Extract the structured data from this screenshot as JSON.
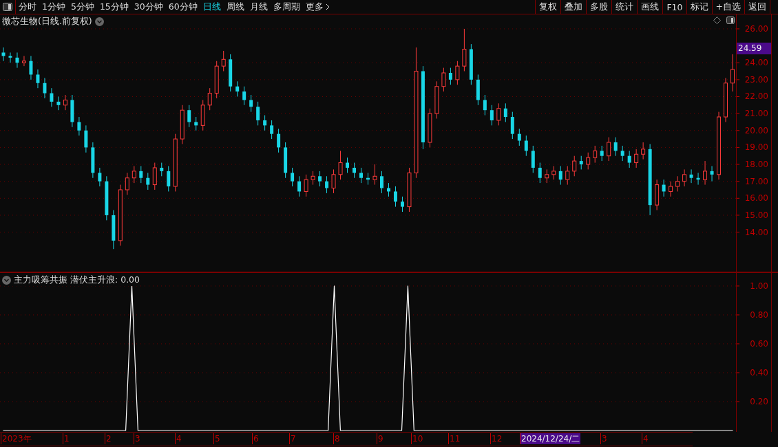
{
  "toolbar": {
    "periods": [
      {
        "label": "分时",
        "selected": false
      },
      {
        "label": "1分钟",
        "selected": false
      },
      {
        "label": "5分钟",
        "selected": false
      },
      {
        "label": "15分钟",
        "selected": false
      },
      {
        "label": "30分钟",
        "selected": false
      },
      {
        "label": "60分钟",
        "selected": false
      },
      {
        "label": "日线",
        "selected": true
      },
      {
        "label": "周线",
        "selected": false
      },
      {
        "label": "月线",
        "selected": false
      },
      {
        "label": "多周期",
        "selected": false
      },
      {
        "label": "更多",
        "selected": false
      }
    ],
    "actions": [
      "复权",
      "叠加",
      "多股",
      "统计",
      "画线",
      "F10",
      "标记",
      "+自选",
      "返回"
    ]
  },
  "price_chart": {
    "title": "微芯生物(日线.前复权)",
    "last_price": "24.59",
    "chart_data": {
      "type": "candlestick",
      "grid": true,
      "ylim": [
        11.75,
        26.85
      ],
      "yticks": [
        {
          "value": 26,
          "label": "26.00"
        },
        {
          "value": 24,
          "label": "24.00"
        },
        {
          "value": 23,
          "label": "23.00"
        },
        {
          "value": 22,
          "label": "22.00"
        },
        {
          "value": 21,
          "label": "21.00"
        },
        {
          "value": 20,
          "label": "20.00"
        },
        {
          "value": 19,
          "label": "19.00"
        },
        {
          "value": 18,
          "label": "18.00"
        },
        {
          "value": 17,
          "label": "17.00"
        },
        {
          "value": 16,
          "label": "16.00"
        },
        {
          "value": 15,
          "label": "15.00"
        },
        {
          "value": 14,
          "label": "14.00"
        }
      ],
      "ohlc": [
        [
          24.6,
          24.9,
          24.1,
          24.4
        ],
        [
          24.4,
          24.6,
          24.0,
          24.3
        ],
        [
          24.3,
          24.6,
          23.7,
          24.0
        ],
        [
          24.0,
          24.4,
          23.8,
          24.1
        ],
        [
          24.1,
          24.4,
          23.0,
          23.3
        ],
        [
          23.3,
          23.6,
          22.5,
          22.8
        ],
        [
          22.8,
          23.1,
          21.9,
          22.2
        ],
        [
          22.2,
          22.5,
          21.4,
          21.7
        ],
        [
          21.7,
          22.0,
          21.2,
          21.5
        ],
        [
          21.5,
          22.1,
          21.2,
          21.8
        ],
        [
          21.8,
          22.1,
          20.2,
          20.5
        ],
        [
          20.5,
          20.8,
          19.7,
          20.0
        ],
        [
          20.0,
          20.3,
          18.7,
          19.0
        ],
        [
          19.0,
          19.3,
          17.2,
          17.5
        ],
        [
          17.5,
          17.8,
          16.7,
          17.0
        ],
        [
          17.0,
          17.3,
          14.7,
          15.0
        ],
        [
          15.0,
          15.3,
          13.0,
          13.5
        ],
        [
          13.5,
          16.8,
          13.2,
          16.5
        ],
        [
          16.5,
          17.5,
          16.2,
          17.2
        ],
        [
          17.2,
          17.9,
          16.9,
          17.6
        ],
        [
          17.6,
          17.9,
          16.9,
          17.2
        ],
        [
          17.2,
          17.5,
          16.5,
          16.8
        ],
        [
          16.8,
          18.1,
          16.5,
          17.8
        ],
        [
          17.8,
          18.1,
          17.3,
          17.6
        ],
        [
          17.6,
          17.9,
          16.4,
          16.7
        ],
        [
          16.7,
          19.8,
          16.4,
          19.5
        ],
        [
          19.5,
          21.5,
          19.2,
          21.2
        ],
        [
          21.2,
          21.5,
          20.2,
          20.5
        ],
        [
          20.5,
          20.8,
          20.0,
          20.3
        ],
        [
          20.3,
          21.8,
          20.0,
          21.5
        ],
        [
          21.5,
          22.5,
          21.2,
          22.2
        ],
        [
          22.2,
          24.1,
          21.9,
          23.8
        ],
        [
          23.8,
          24.7,
          23.5,
          24.2
        ],
        [
          24.2,
          24.5,
          22.3,
          22.6
        ],
        [
          22.6,
          22.9,
          22.0,
          22.3
        ],
        [
          22.3,
          22.6,
          21.5,
          21.8
        ],
        [
          21.8,
          22.1,
          21.1,
          21.4
        ],
        [
          21.4,
          21.7,
          20.3,
          20.6
        ],
        [
          20.6,
          20.9,
          20.0,
          20.3
        ],
        [
          20.3,
          20.6,
          19.5,
          19.8
        ],
        [
          19.8,
          20.1,
          18.7,
          19.0
        ],
        [
          19.0,
          19.3,
          17.2,
          17.5
        ],
        [
          17.5,
          17.8,
          16.7,
          17.0
        ],
        [
          17.0,
          17.3,
          16.1,
          16.4
        ],
        [
          16.4,
          17.4,
          16.1,
          17.1
        ],
        [
          17.1,
          17.6,
          16.8,
          17.3
        ],
        [
          17.3,
          17.6,
          16.7,
          17.0
        ],
        [
          17.0,
          17.3,
          16.3,
          16.6
        ],
        [
          16.6,
          17.7,
          16.3,
          17.4
        ],
        [
          17.4,
          18.8,
          17.1,
          18.1
        ],
        [
          18.1,
          18.4,
          17.5,
          17.8
        ],
        [
          17.8,
          18.1,
          17.2,
          17.5
        ],
        [
          17.5,
          17.8,
          16.9,
          17.2
        ],
        [
          17.2,
          17.5,
          16.8,
          17.1
        ],
        [
          17.1,
          18.0,
          16.8,
          17.3
        ],
        [
          17.3,
          17.6,
          16.3,
          16.6
        ],
        [
          16.6,
          16.9,
          16.1,
          16.4
        ],
        [
          16.4,
          16.7,
          15.5,
          15.8
        ],
        [
          15.8,
          16.1,
          15.2,
          15.5
        ],
        [
          15.5,
          17.8,
          15.2,
          17.5
        ],
        [
          17.5,
          24.9,
          17.2,
          23.5
        ],
        [
          23.5,
          23.8,
          18.9,
          19.3
        ],
        [
          19.3,
          21.3,
          19.0,
          21.0
        ],
        [
          21.0,
          22.9,
          20.7,
          22.6
        ],
        [
          22.6,
          23.7,
          22.3,
          23.4
        ],
        [
          23.4,
          23.7,
          22.7,
          23.0
        ],
        [
          23.0,
          24.1,
          22.7,
          23.8
        ],
        [
          23.8,
          26.0,
          23.5,
          24.8
        ],
        [
          24.8,
          25.1,
          22.7,
          23.0
        ],
        [
          23.0,
          23.3,
          21.5,
          21.8
        ],
        [
          21.8,
          22.1,
          20.9,
          21.2
        ],
        [
          21.2,
          21.5,
          20.3,
          20.6
        ],
        [
          20.6,
          21.6,
          20.3,
          21.3
        ],
        [
          21.3,
          21.6,
          20.5,
          20.8
        ],
        [
          20.8,
          21.1,
          19.5,
          19.8
        ],
        [
          19.8,
          20.1,
          19.1,
          19.4
        ],
        [
          19.4,
          19.7,
          18.5,
          18.8
        ],
        [
          18.8,
          19.1,
          17.5,
          17.8
        ],
        [
          17.8,
          18.1,
          16.9,
          17.2
        ],
        [
          17.2,
          17.7,
          16.9,
          17.4
        ],
        [
          17.4,
          17.9,
          17.1,
          17.6
        ],
        [
          17.6,
          17.9,
          16.8,
          17.1
        ],
        [
          17.1,
          17.9,
          16.8,
          17.6
        ],
        [
          17.6,
          18.5,
          17.3,
          18.2
        ],
        [
          18.2,
          18.5,
          17.7,
          18.0
        ],
        [
          18.0,
          18.7,
          17.7,
          18.4
        ],
        [
          18.4,
          19.1,
          18.1,
          18.8
        ],
        [
          18.8,
          19.1,
          18.2,
          18.5
        ],
        [
          18.5,
          19.6,
          18.2,
          19.3
        ],
        [
          19.3,
          19.6,
          18.5,
          18.8
        ],
        [
          18.8,
          19.1,
          18.2,
          18.5
        ],
        [
          18.5,
          18.8,
          17.8,
          18.1
        ],
        [
          18.1,
          18.9,
          17.8,
          18.6
        ],
        [
          18.6,
          19.3,
          18.3,
          18.9
        ],
        [
          18.9,
          19.2,
          15.0,
          15.6
        ],
        [
          15.6,
          17.1,
          15.3,
          16.8
        ],
        [
          16.8,
          17.1,
          16.1,
          16.4
        ],
        [
          16.4,
          17.0,
          16.1,
          16.7
        ],
        [
          16.7,
          17.3,
          16.4,
          17.0
        ],
        [
          17.0,
          17.7,
          16.7,
          17.4
        ],
        [
          17.4,
          17.7,
          16.9,
          17.2
        ],
        [
          17.2,
          17.5,
          16.8,
          17.1
        ],
        [
          17.1,
          18.2,
          16.8,
          17.6
        ],
        [
          17.6,
          17.9,
          17.0,
          17.4
        ],
        [
          17.4,
          21.1,
          17.1,
          20.8
        ],
        [
          20.8,
          23.1,
          20.5,
          22.8
        ],
        [
          22.8,
          24.5,
          22.3,
          23.6
        ]
      ]
    }
  },
  "indicator": {
    "reading": ": 0.00",
    "chart_data": {
      "type": "line",
      "title": "主力吸筹共振",
      "grid": true,
      "ylim": [
        0,
        1.09
      ],
      "yticks": [
        {
          "value": 1,
          "label": "1.00"
        },
        {
          "value": 0.8,
          "label": "0.80"
        },
        {
          "value": 0.6,
          "label": "0.60"
        },
        {
          "value": 0.4,
          "label": "0.40"
        },
        {
          "value": 0.2,
          "label": "0.20"
        }
      ],
      "series": [
        {
          "name": "潜伏主升浪",
          "color": "#ffffff",
          "values": [
            0,
            0,
            0,
            0,
            0,
            0,
            0,
            0,
            0,
            0,
            0,
            0,
            0,
            0,
            0,
            0,
            0,
            0,
            0,
            0,
            0,
            1,
            0,
            0,
            0,
            0,
            0,
            0,
            0,
            0,
            0,
            0,
            0,
            0,
            0,
            0,
            0,
            0,
            0,
            0,
            0,
            0,
            0,
            0,
            0,
            0,
            0,
            0,
            0,
            0,
            0,
            0,
            0,
            0,
            1,
            0,
            0,
            0,
            0,
            0,
            0,
            0,
            0,
            0,
            0,
            0,
            1,
            0,
            0,
            0,
            0,
            0,
            0,
            0,
            0,
            0,
            0,
            0,
            0,
            0,
            0,
            0,
            0,
            0,
            0,
            0,
            0,
            0,
            0,
            0,
            0,
            0,
            0,
            0,
            0,
            0,
            0,
            0,
            0,
            0,
            0,
            0,
            0,
            0,
            0,
            0,
            0,
            0,
            0,
            0,
            0,
            0,
            0,
            0,
            0,
            0,
            0,
            0,
            0,
            0
          ]
        }
      ]
    }
  },
  "date_axis": [
    {
      "label": "2023年",
      "selected": false
    },
    {
      "label": "1",
      "selected": false
    },
    {
      "label": "2",
      "selected": false
    },
    {
      "label": "3",
      "selected": false
    },
    {
      "label": "4",
      "selected": false
    },
    {
      "label": "5",
      "selected": false
    },
    {
      "label": "6",
      "selected": false
    },
    {
      "label": "7",
      "selected": false
    },
    {
      "label": "8",
      "selected": false
    },
    {
      "label": "9",
      "selected": false
    },
    {
      "label": "10",
      "selected": false
    },
    {
      "label": "11",
      "selected": false
    },
    {
      "label": "12",
      "selected": false
    },
    {
      "label": "2024/12/24/二",
      "selected": true
    },
    {
      "label": "3",
      "selected": false
    },
    {
      "label": "4",
      "selected": false
    }
  ]
}
